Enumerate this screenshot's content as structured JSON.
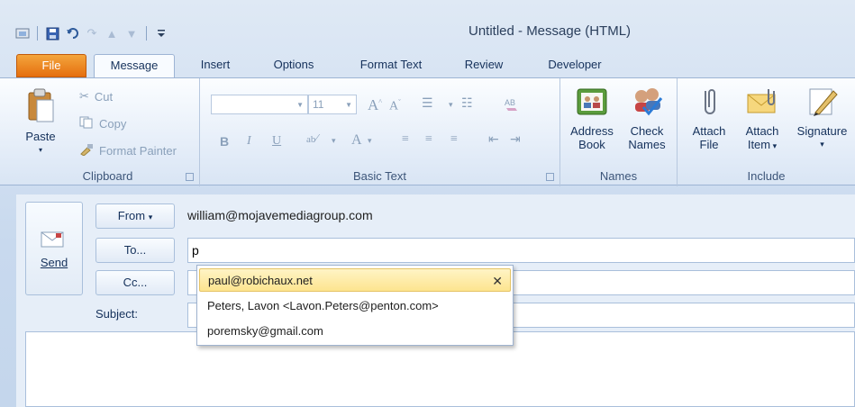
{
  "window": {
    "title": "Untitled  -  Message (HTML)"
  },
  "tabs": [
    "File",
    "Message",
    "Insert",
    "Options",
    "Format Text",
    "Review",
    "Developer"
  ],
  "clipboard": {
    "paste": "Paste",
    "cut": "Cut",
    "copy": "Copy",
    "format_painter": "Format Painter",
    "label": "Clipboard"
  },
  "basic_text": {
    "font_size": "11",
    "label": "Basic Text"
  },
  "names": {
    "address_book_line1": "Address",
    "address_book_line2": "Book",
    "check_names_line1": "Check",
    "check_names_line2": "Names",
    "label": "Names"
  },
  "include": {
    "attach_file_line1": "Attach",
    "attach_file_line2": "File",
    "attach_item_line1": "Attach",
    "attach_item_line2": "Item",
    "signature": "Signature",
    "label": "Include"
  },
  "compose": {
    "send": "Send",
    "from_label": "From",
    "from_value": "william@mojavemediagroup.com",
    "to_label": "To...",
    "to_value": "p",
    "cc_label": "Cc...",
    "subject_label": "Subject:"
  },
  "autocomplete": [
    "paul@robichaux.net",
    "Peters, Lavon <Lavon.Peters@penton.com>",
    "poremsky@gmail.com"
  ],
  "colors": {
    "file_tab": "#e56f0f",
    "selection": "#fde48f",
    "ribbon": "#e3ecf8"
  }
}
